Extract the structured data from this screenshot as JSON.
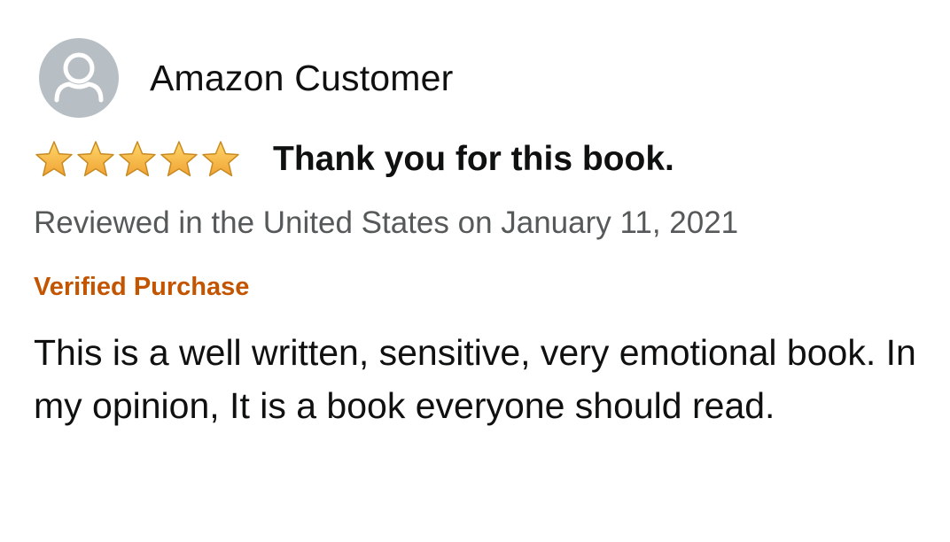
{
  "review": {
    "profile": {
      "name": "Amazon Customer",
      "avatar_icon": "person-silhouette-icon",
      "avatar_bg": "#b8bfc4"
    },
    "rating": {
      "stars": 5,
      "max_stars": 5,
      "star_icon": "star-icon",
      "star_color": "#f3a847"
    },
    "title": "Thank you for this book.",
    "date": "Reviewed in the United States on January 11, 2021",
    "verified_label": "Verified Purchase",
    "verified_color": "#c45500",
    "body": "This is a well written, sensitive, very emotional book. In my opinion, It is a book everyone should read."
  }
}
